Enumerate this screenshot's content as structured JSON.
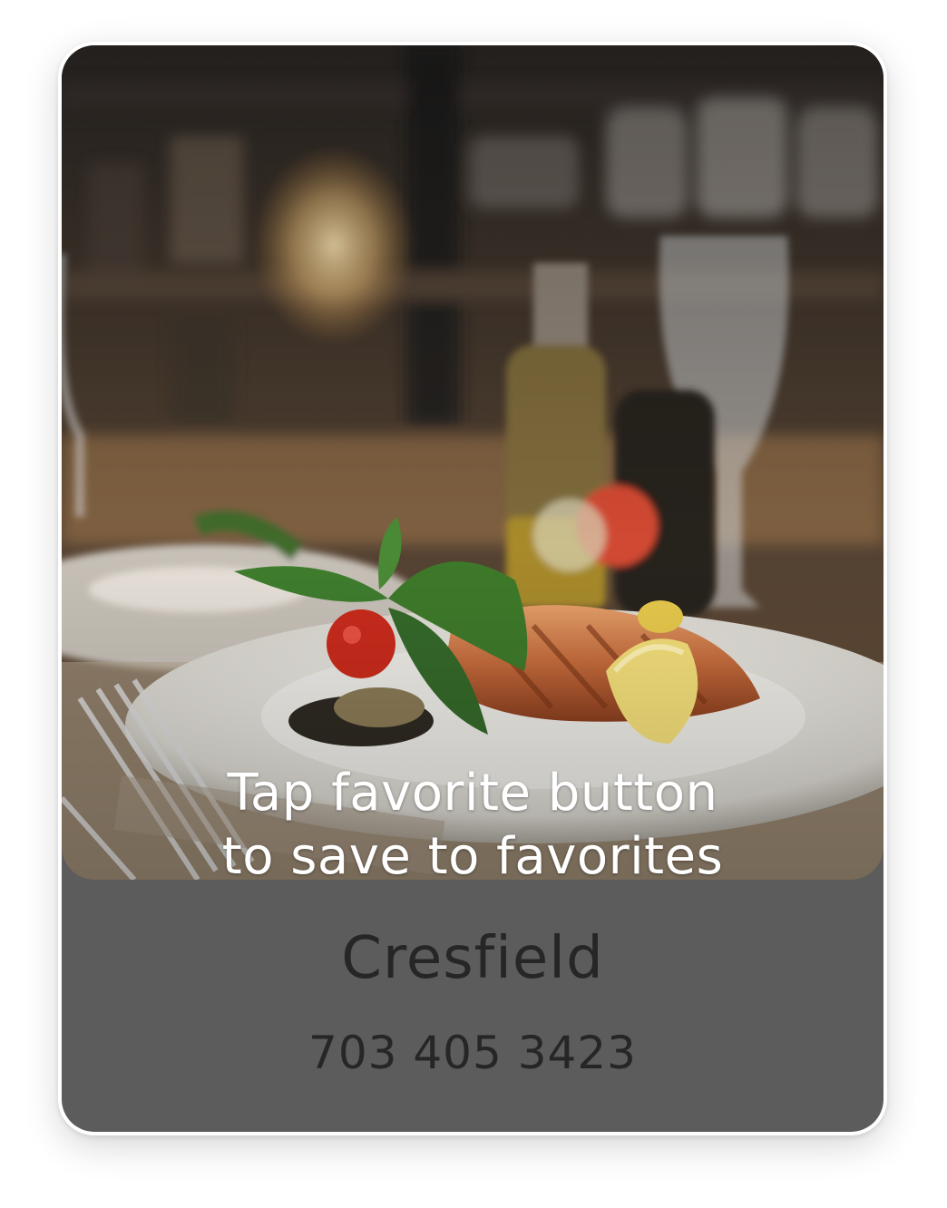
{
  "card": {
    "hero_image": "restaurant-salmon-dish-photo",
    "hint_line_1": "Tap favorite button",
    "hint_line_2": "to save to favorites",
    "name": "Cresfield",
    "phone": "703 405 3423"
  },
  "colors": {
    "card_footer": "#5c5c5c",
    "text_dark": "#262626",
    "hint_text": "#ffffff"
  }
}
